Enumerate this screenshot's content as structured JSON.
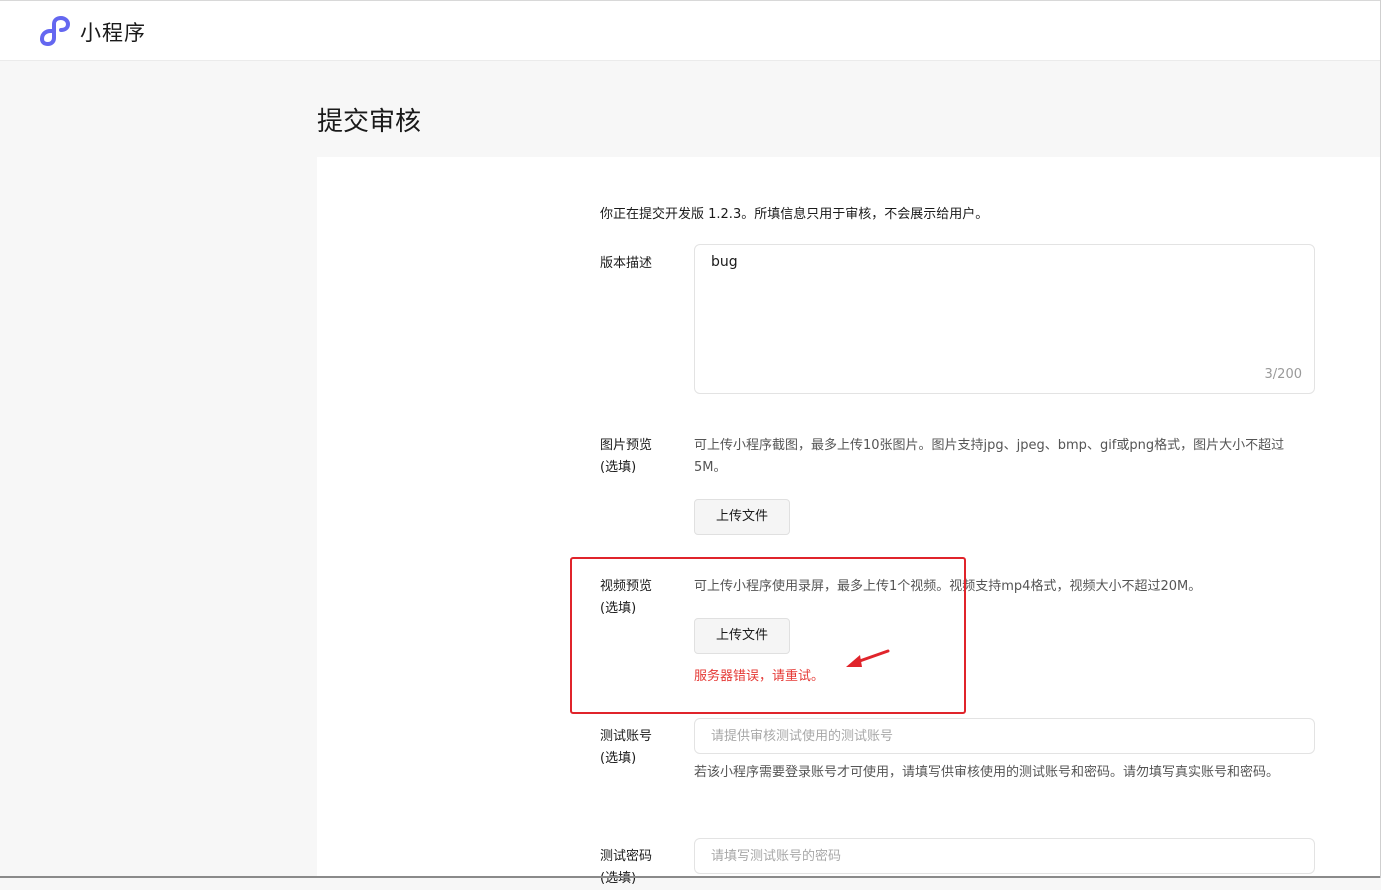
{
  "header": {
    "brand": "小程序",
    "logo_icon": "mini-program-logo-icon",
    "accent_color": "#6467f0"
  },
  "page": {
    "title": "提交审核"
  },
  "form": {
    "intro": "你正在提交开发版 1.2.3。所填信息只用于审核，不会展示给用户。",
    "description": {
      "label": "版本描述",
      "value": "bug",
      "counter": "3/200"
    },
    "image_preview": {
      "label": "图片预览",
      "sublabel": "(选填)",
      "hint": "可上传小程序截图，最多上传10张图片。图片支持jpg、jpeg、bmp、gif或png格式，图片大小不超过5M。",
      "button": "上传文件"
    },
    "video_preview": {
      "label": "视频预览",
      "sublabel": "(选填)",
      "hint": "可上传小程序使用录屏，最多上传1个视频。视频支持mp4格式，视频大小不超过20M。",
      "button": "上传文件",
      "error": "服务器错误，请重试。",
      "error_color": "#e53935"
    },
    "test_account": {
      "label": "测试账号",
      "sublabel": "(选填)",
      "placeholder": "请提供审核测试使用的测试账号",
      "hint": "若该小程序需要登录账号才可使用，请填写供审核使用的测试账号和密码。请勿填写真实账号和密码。"
    },
    "test_password": {
      "label": "测试密码",
      "sublabel": "(选填)",
      "placeholder": "请填写测试账号的密码"
    }
  },
  "annotation": {
    "highlight_color": "#e0242b",
    "arrow_icon": "red-arrow-icon"
  }
}
